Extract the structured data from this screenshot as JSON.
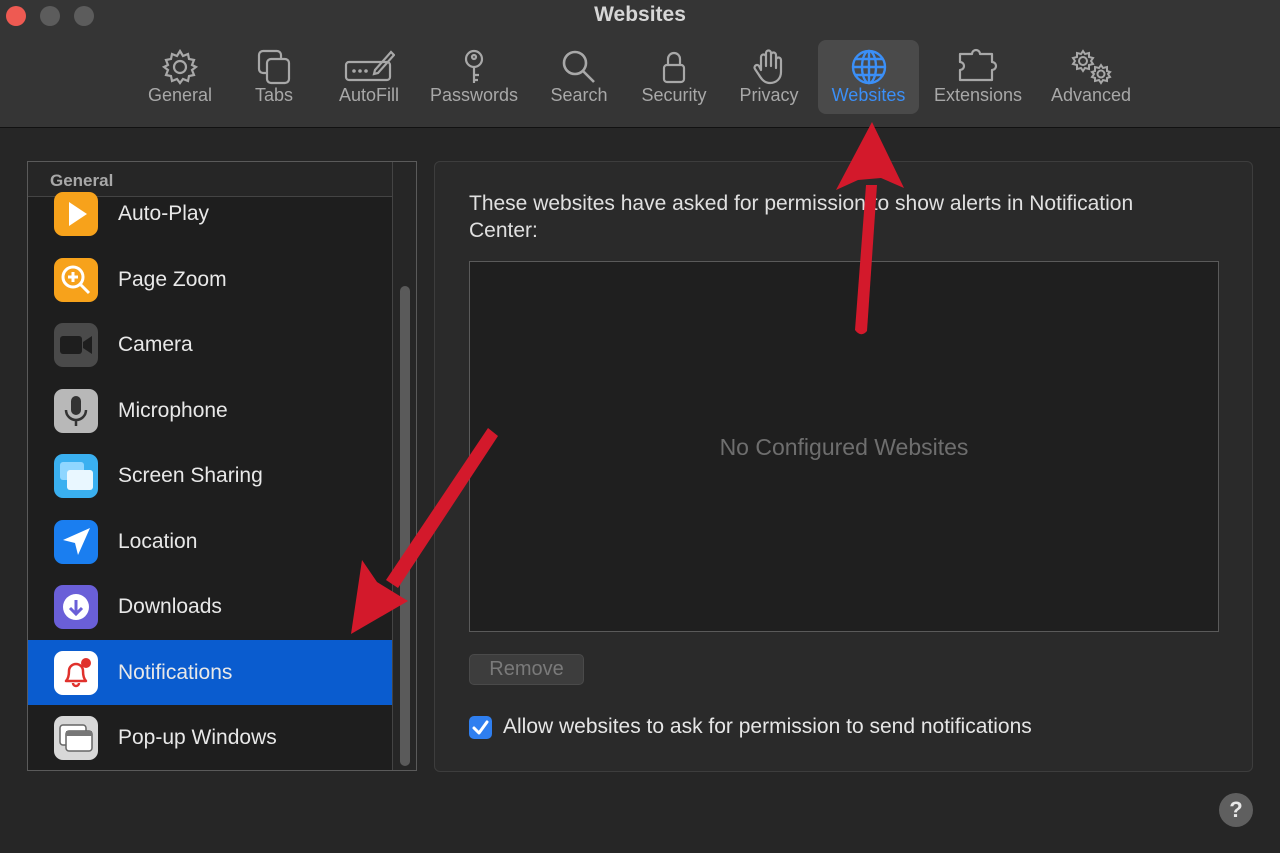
{
  "window": {
    "title": "Websites"
  },
  "toolbar": {
    "tabs": [
      {
        "label": "General",
        "icon": "gear-icon"
      },
      {
        "label": "Tabs",
        "icon": "tabs-icon"
      },
      {
        "label": "AutoFill",
        "icon": "autofill-icon"
      },
      {
        "label": "Passwords",
        "icon": "key-icon"
      },
      {
        "label": "Search",
        "icon": "search-icon"
      },
      {
        "label": "Security",
        "icon": "lock-icon"
      },
      {
        "label": "Privacy",
        "icon": "hand-icon"
      },
      {
        "label": "Websites",
        "icon": "globe-icon",
        "selected": true
      },
      {
        "label": "Extensions",
        "icon": "puzzle-icon"
      },
      {
        "label": "Advanced",
        "icon": "gears-icon"
      }
    ]
  },
  "sidebar": {
    "header": "General",
    "items": [
      {
        "label": "Auto-Play",
        "icon": "play-icon",
        "color": "#f7a21b"
      },
      {
        "label": "Page Zoom",
        "icon": "zoom-icon",
        "color": "#f7a21b"
      },
      {
        "label": "Camera",
        "icon": "camera-icon",
        "color": "#4a4a4a"
      },
      {
        "label": "Microphone",
        "icon": "microphone-icon",
        "color": "#b8b8b8"
      },
      {
        "label": "Screen Sharing",
        "icon": "screen-sharing-icon",
        "color": "#3ab0f0"
      },
      {
        "label": "Location",
        "icon": "location-icon",
        "color": "#1a7ef0"
      },
      {
        "label": "Downloads",
        "icon": "download-icon",
        "color": "#6a5fd8"
      },
      {
        "label": "Notifications",
        "icon": "bell-icon",
        "color": "#ffffff",
        "selected": true
      },
      {
        "label": "Pop-up Windows",
        "icon": "popup-windows-icon",
        "color": "#d8d8d8"
      }
    ]
  },
  "main": {
    "description": "These websites have asked for permission to show alerts in Notification Center:",
    "empty_text": "No Configured Websites",
    "remove_label": "Remove",
    "allow_checkbox": {
      "label": "Allow websites to ask for permission to send notifications",
      "checked": true
    }
  },
  "help": {
    "label": "?"
  },
  "colors": {
    "accent": "#0a5ccf",
    "selected_tab": "#3b8ff7",
    "annotation_arrow": "#d3192b"
  }
}
